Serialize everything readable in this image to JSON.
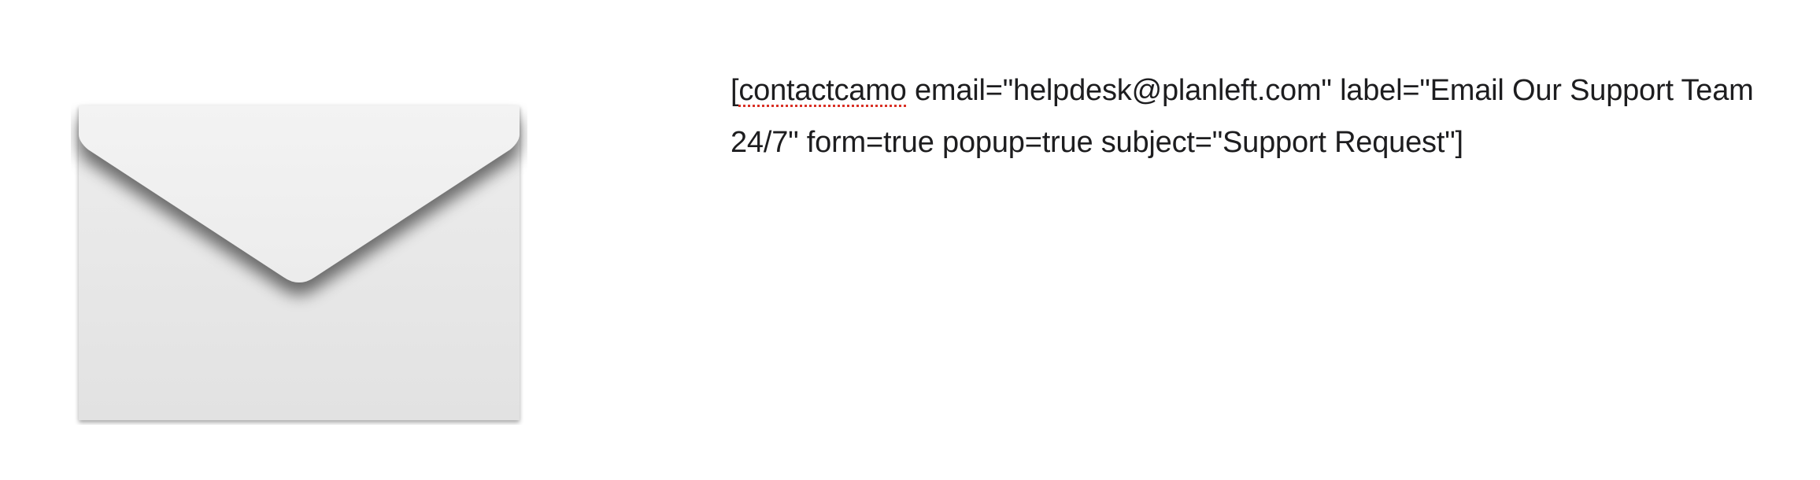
{
  "media": {
    "image_icon": "envelope-icon"
  },
  "shortcode": {
    "open_bracket": "[",
    "tag": "contactcamo",
    "attributes": " email=\"helpdesk@planleft.com\" label=\"Email Our Support Team 24/7\" form=true popup=true subject=\"Support Request\"]"
  },
  "colors": {
    "text": "#1d1d1f",
    "spellcheck_underline": "#d93025",
    "background": "#ffffff"
  }
}
